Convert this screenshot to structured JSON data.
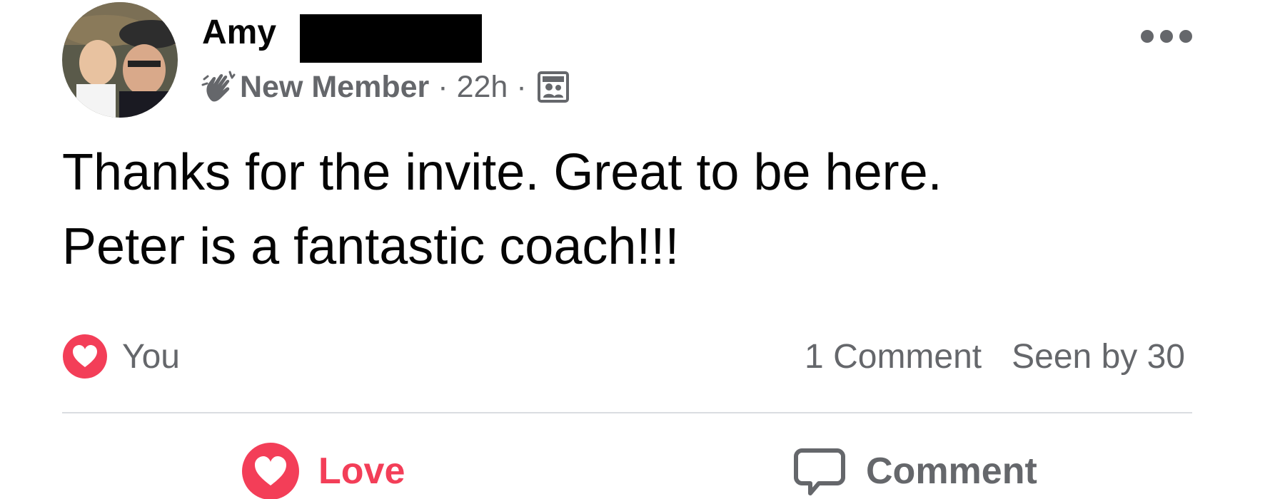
{
  "post": {
    "author_name": "Amy",
    "badge": "New Member",
    "separator": "·",
    "time": "22h",
    "audience_icon": "group-icon",
    "body_line1": "Thanks for the invite. Great to be here.",
    "body_line2": "Peter is a fantastic coach!!!"
  },
  "reactions": {
    "icon": "love-reaction-icon",
    "reactor": "You",
    "comments": "1 Comment",
    "seen": "Seen by 30"
  },
  "actions": {
    "love_label": "Love",
    "comment_label": "Comment"
  },
  "colors": {
    "love": "#f33e58",
    "secondary_text": "#65676b",
    "primary_text": "#050505",
    "divider": "#dadde1"
  }
}
